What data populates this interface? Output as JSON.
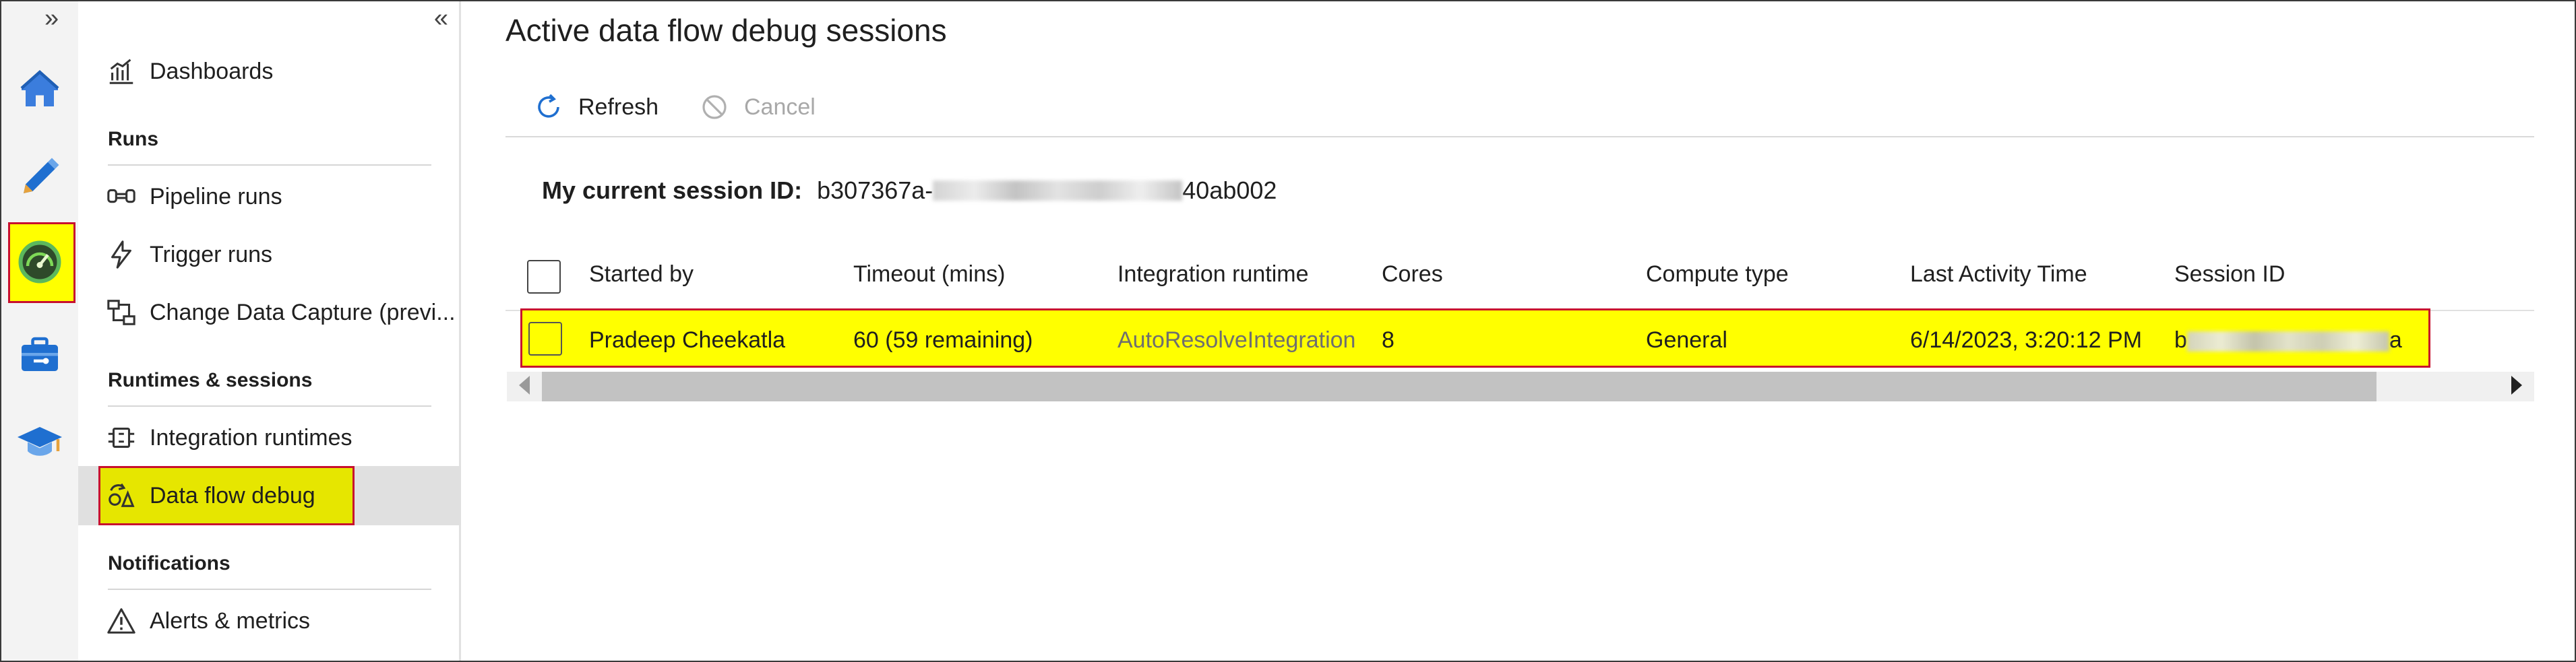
{
  "rail": {
    "expand_glyph": "»",
    "items": [
      {
        "icon": "home-icon",
        "color": "#3b7ddd"
      },
      {
        "icon": "author-pencil-icon",
        "color": "#1f6fd0"
      },
      {
        "icon": "monitor-gauge-icon",
        "color": "#2e7d32",
        "selected": true
      },
      {
        "icon": "manage-toolbox-icon",
        "color": "#1f6fd0"
      },
      {
        "icon": "learning-center-icon",
        "color": "#1f6fd0"
      }
    ]
  },
  "nav": {
    "collapse_glyph": "«",
    "dashboards": "Dashboards",
    "runs_section": "Runs",
    "pipeline_runs": "Pipeline runs",
    "trigger_runs": "Trigger runs",
    "change_data_capture": "Change Data Capture (previ...",
    "runtimes_section": "Runtimes & sessions",
    "integration_runtimes": "Integration runtimes",
    "data_flow_debug": "Data flow debug",
    "notifications_section": "Notifications",
    "alerts_metrics": "Alerts & metrics"
  },
  "main": {
    "title": "Active data flow debug sessions",
    "toolbar": {
      "refresh_label": "Refresh",
      "cancel_label": "Cancel"
    },
    "session": {
      "label": "My current session ID:",
      "id_prefix": "b307367a-",
      "id_suffix": "40ab002"
    },
    "table": {
      "columns": [
        "Started by",
        "Timeout (mins)",
        "Integration runtime",
        "Cores",
        "Compute type",
        "Last Activity Time",
        "Session ID"
      ],
      "rows": [
        {
          "started_by": "Pradeep Cheekatla",
          "timeout": "60 (59 remaining)",
          "integration_runtime": "AutoResolveIntegration",
          "cores": "8",
          "compute_type": "General",
          "last_activity": "6/14/2023, 3:20:12 PM",
          "session_id_prefix": "b",
          "session_id_suffix": "a"
        }
      ]
    }
  },
  "colors": {
    "highlight": "#ffff00",
    "annotation_border": "#c8102e",
    "accent": "#1f6fd0"
  }
}
